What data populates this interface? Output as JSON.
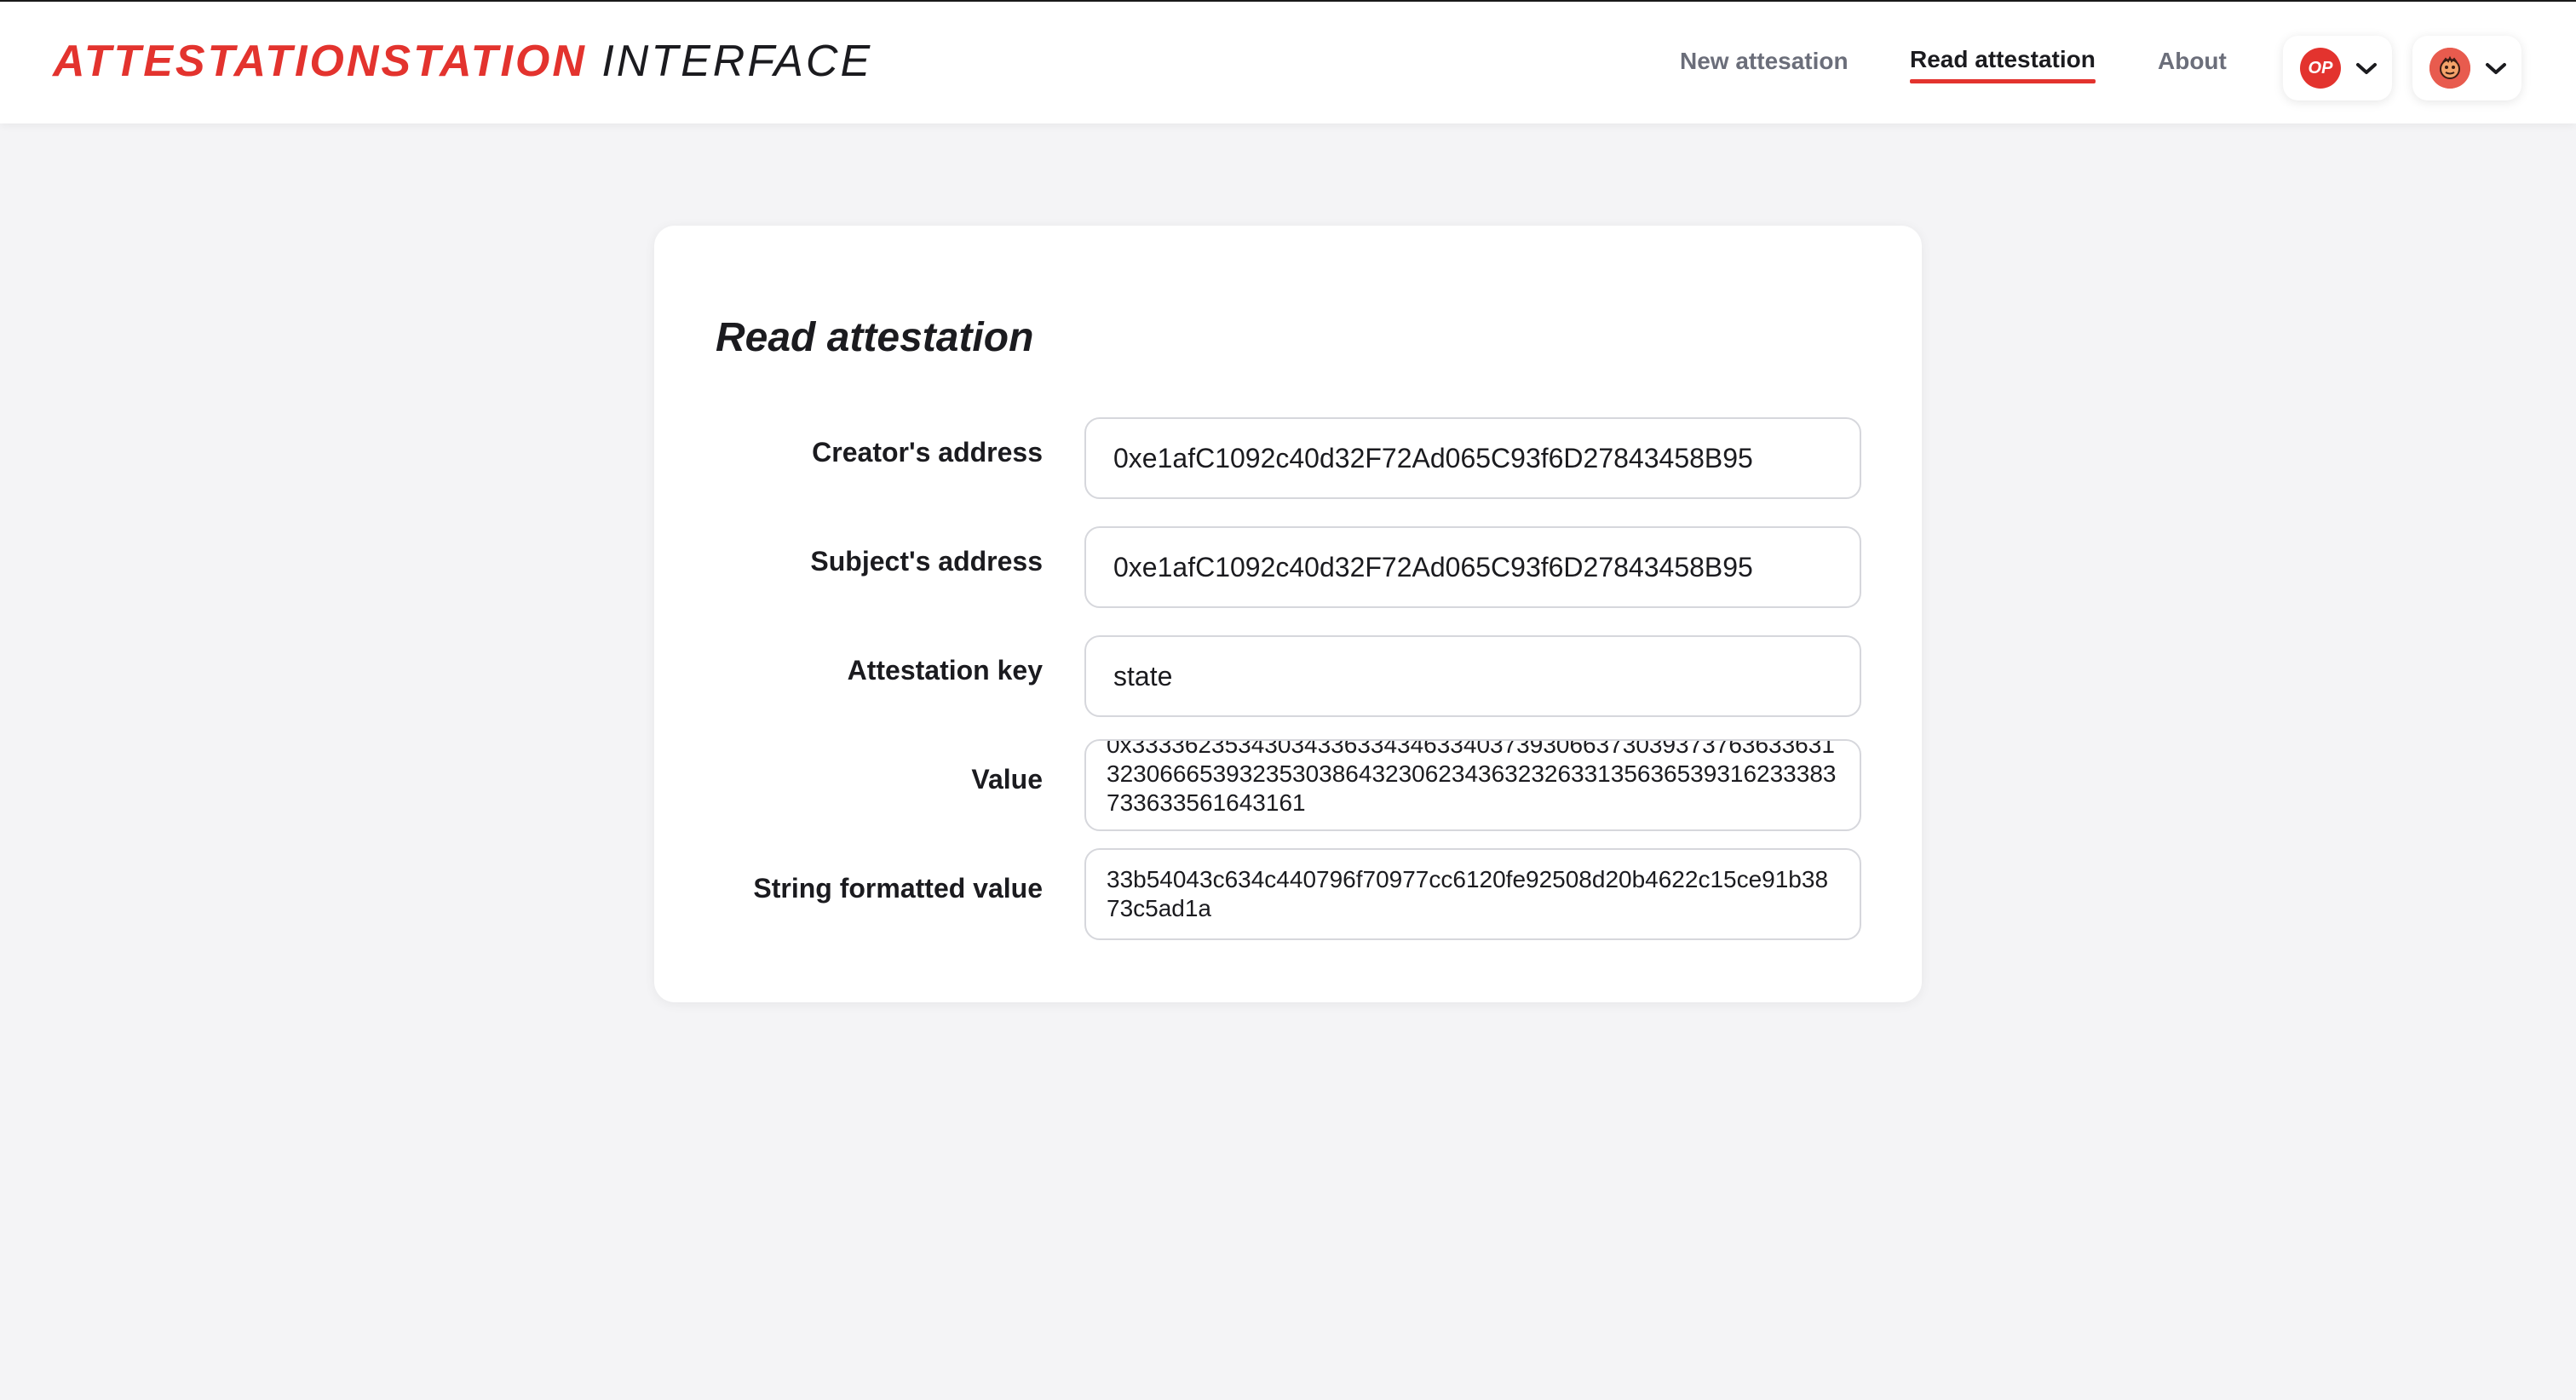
{
  "header": {
    "logo_brand": "ATTESTATIONSTATION",
    "logo_suffix": "INTERFACE",
    "nav": [
      {
        "label": "New attesation",
        "active": false
      },
      {
        "label": "Read attestation",
        "active": true
      },
      {
        "label": "About",
        "active": false
      }
    ],
    "network_badge": "OP",
    "icons": {
      "network_menu": "chevron-down-icon",
      "account_menu": "chevron-down-icon",
      "account_avatar": "avatar-icon"
    }
  },
  "card": {
    "title": "Read attestation",
    "fields": {
      "creator": {
        "label": "Creator's address",
        "value": "0xe1afC1092c40d32F72Ad065C93f6D27843458B95"
      },
      "subject": {
        "label": "Subject's address",
        "value": "0xe1afC1092c40d32F72Ad065C93f6D27843458B95"
      },
      "key": {
        "label": "Attestation key",
        "value": "state"
      },
      "value": {
        "label": "Value",
        "value": "0x333362353430343363343463340373930663730393737636336313230666539323530386432306234363232633135636539316233383733633561643161"
      },
      "string_value": {
        "label": "String formatted value",
        "value": "33b54043c634c440796f70977cc6120fe92508d20b4622c15ce91b3873c5ad1a"
      }
    }
  },
  "colors": {
    "accent": "#e3332e",
    "background": "#f4f4f6",
    "card": "#ffffff",
    "nav_inactive": "#6b6e7a",
    "text": "#1b1b1f"
  }
}
